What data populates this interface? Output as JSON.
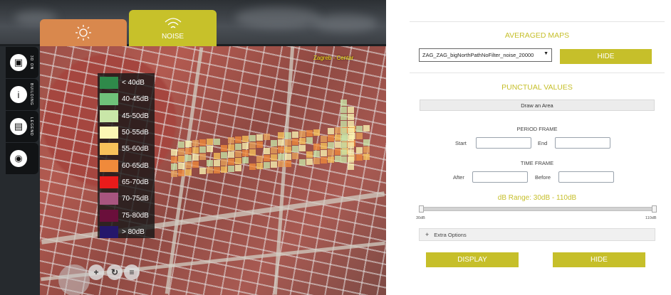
{
  "map": {
    "tabs": [
      {
        "label": "",
        "icon": "sun-icon",
        "color": "#d9884d"
      },
      {
        "label": "NOISE",
        "icon": "wifi-signal-icon",
        "color": "#c7c12a"
      }
    ],
    "place_label": "Zagreb - Centar",
    "side_buttons": [
      {
        "label": "3D ON",
        "icon": "cube-icon"
      },
      {
        "label": "BUILDING",
        "icon": "info-icon"
      },
      {
        "label": "LEGEND",
        "icon": "document-icon"
      },
      {
        "label": "",
        "icon": "location-pin-icon"
      }
    ],
    "legend": [
      {
        "label": "< 40dB",
        "color": "#2f8a4a"
      },
      {
        "label": "40-45dB",
        "color": "#6fc27a"
      },
      {
        "label": "45-50dB",
        "color": "#c9e6a8"
      },
      {
        "label": "50-55dB",
        "color": "#fbf6b4"
      },
      {
        "label": "55-60dB",
        "color": "#f7c15a"
      },
      {
        "label": "60-65dB",
        "color": "#f08a3b"
      },
      {
        "label": "65-70dB",
        "color": "#e81b1b"
      },
      {
        "label": "70-75dB",
        "color": "#a8557f"
      },
      {
        "label": "75-80dB",
        "color": "#6a0f3b"
      },
      {
        "label": "> 80dB",
        "color": "#25176b"
      }
    ]
  },
  "panel": {
    "averaged_title": "AVERAGED MAPS",
    "select_value": "ZAG_ZAG_bigNorthPathNoFilter_noise_20000",
    "hide_label": "HIDE",
    "punctual_title": "PUNCTUAL VALUES",
    "draw_area_label": "Draw an Area",
    "period_title": "PERIOD FRAME",
    "start_label": "Start",
    "end_label": "End",
    "time_title": "TIME FRAME",
    "after_label": "After",
    "before_label": "Before",
    "range_label": "dB Range: 30dB - 110dB",
    "range_min": "30dB",
    "range_max": "110dB",
    "extra_options_label": "Extra Options",
    "display_label": "DISPLAY",
    "hide_bottom_label": "HIDE"
  }
}
